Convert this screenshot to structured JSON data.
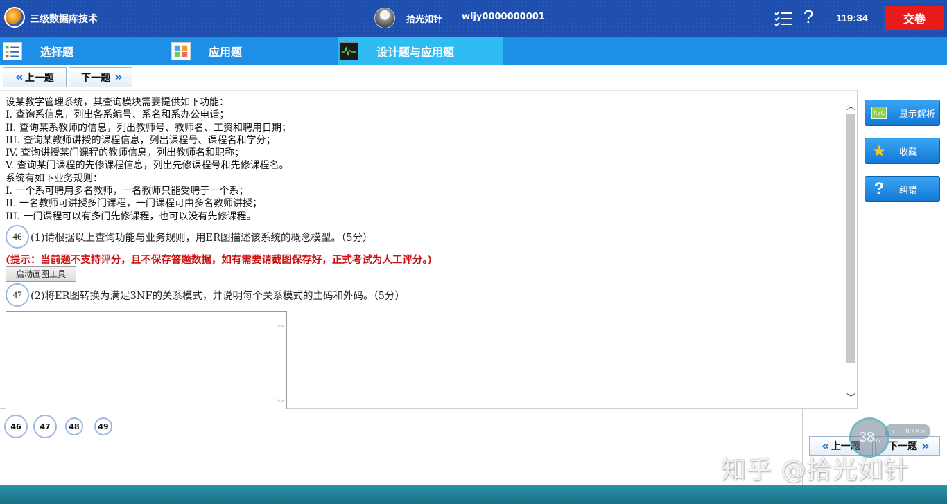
{
  "header": {
    "app_title": "三级数据库技术",
    "user_name": "拾光如针",
    "user_id": "wljy0000000001",
    "timer": "119:34",
    "submit_label": "交卷"
  },
  "tabs": [
    {
      "label": "选择题",
      "icon": "list-icon"
    },
    {
      "label": "应用题",
      "icon": "grid-icon"
    },
    {
      "label": "设计题与应用题",
      "icon": "monitor-icon",
      "active": true
    }
  ],
  "nav": {
    "prev_label": "上一题",
    "next_label": "下一题"
  },
  "question": {
    "lines": [
      "设某教学管理系统，其查询模块需要提供如下功能：",
      "I.  查询系信息，列出各系编号、系名和系办公电话；",
      "II.  查询某系教师的信息，列出教师号、教师名、工资和聘用日期；",
      "III.  查询某教师讲授的课程信息，列出课程号、课程名和学分；",
      "IV.  查询讲授某门课程的教师信息，列出教师名和职称；",
      "V.  查询某门课程的先修课程信息，列出先修课程号和先修课程名。",
      "系统有如下业务规则：",
      "I.  一个系可聘用多名教师，一名教师只能受聘于一个系；",
      "II.  一名教师可讲授多门课程，一门课程可由多名教师讲授；",
      "III.  一门课程可以有多门先修课程，也可以没有先修课程。"
    ],
    "sub1_num": "46",
    "sub1_text": "(1)请根据以上查询功能与业务规则，用ER图描述该系统的概念模型。（5分）",
    "hint": "(提示：当前题不支持评分，且不保存答题数据，如有需要请截图保存好，正式考试为人工评分。)",
    "draw_tool_label": "启动画图工具",
    "sub2_num": "47",
    "sub2_text": "(2)将ER图转换为满足3NF的关系模式，并说明每个关系模式的主码和外码。（5分）",
    "answer_value": ""
  },
  "tools": [
    {
      "label": "显示解析",
      "icon": "abc-icon"
    },
    {
      "label": "收藏",
      "icon": "star-icon"
    },
    {
      "label": "纠错",
      "icon": "question-icon"
    }
  ],
  "question_nav": [
    "46",
    "47",
    "48",
    "49"
  ],
  "speed": {
    "percent": "38",
    "unit": "%",
    "rate": "0.2",
    "rate_unit": "K/s"
  },
  "watermark": "知乎 @拾光如针"
}
